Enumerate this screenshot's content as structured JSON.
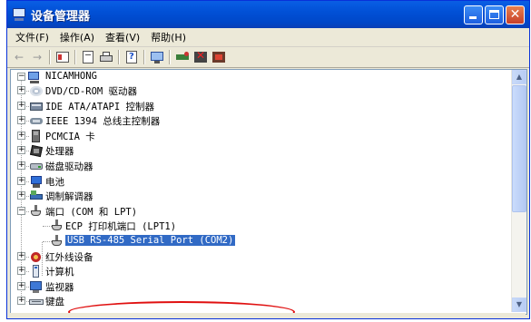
{
  "window": {
    "title": "设备管理器",
    "controls": {
      "minimize": "minimize",
      "maximize": "maximize",
      "close": "✕"
    }
  },
  "menu": [
    {
      "label": "文件(F)"
    },
    {
      "label": "操作(A)"
    },
    {
      "label": "查看(V)"
    },
    {
      "label": "帮助(H)"
    }
  ],
  "toolbar": [
    "back-icon",
    "forward-icon",
    "view-icon",
    "properties-icon",
    "print-icon",
    "help-icon",
    "scan-hardware-icon",
    "update-driver-icon",
    "uninstall-icon",
    "disable-icon"
  ],
  "tree": {
    "root": {
      "label": "NICAMHONG"
    },
    "items": [
      {
        "label": "DVD/CD-ROM 驱动器",
        "icon": "dvd-drive-icon",
        "expander": "+"
      },
      {
        "label": "IDE ATA/ATAPI 控制器",
        "icon": "ide-controller-icon",
        "expander": "+"
      },
      {
        "label": "IEEE 1394 总线主控制器",
        "icon": "ieee1394-icon",
        "expander": "+"
      },
      {
        "label": "PCMCIA 卡",
        "icon": "pcmcia-icon",
        "expander": "+"
      },
      {
        "label": "处理器",
        "icon": "processor-icon",
        "expander": "+"
      },
      {
        "label": "磁盘驱动器",
        "icon": "disk-drive-icon",
        "expander": "+"
      },
      {
        "label": "电池",
        "icon": "battery-icon",
        "expander": "+"
      },
      {
        "label": "调制解调器",
        "icon": "modem-icon",
        "expander": "+"
      },
      {
        "label": "端口 (COM 和 LPT)",
        "icon": "port-icon",
        "expander": "−"
      }
    ],
    "ports_children": [
      {
        "label": "ECP 打印机端口 (LPT1)",
        "icon": "port-icon"
      },
      {
        "label": "USB RS-485 Serial Port (COM2)",
        "icon": "port-icon",
        "selected": true
      }
    ],
    "after_items": [
      {
        "label": "红外线设备",
        "icon": "infrared-icon",
        "expander": "+"
      },
      {
        "label": "计算机",
        "icon": "computer-icon",
        "expander": "+"
      },
      {
        "label": "监视器",
        "icon": "monitor-icon",
        "expander": "+"
      },
      {
        "label": "键盘",
        "icon": "keyboard-icon",
        "expander": "+"
      }
    ]
  },
  "colors": {
    "selection": "#316ac5",
    "highlight_oval": "#e01010",
    "titlebar": "#0150d6"
  }
}
